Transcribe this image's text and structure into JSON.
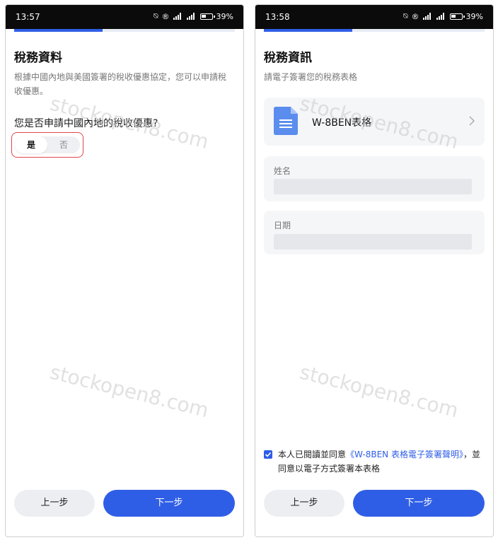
{
  "left": {
    "status": {
      "time": "13:57",
      "battery": "39"
    },
    "progress_fraction": 0.4,
    "title": "稅務資料",
    "subtitle": "根據中國內地與美國簽署的稅收優惠協定，您可以申請稅收優惠。",
    "question": "您是否申請中國內地的稅收優惠?",
    "toggle": {
      "yes": "是",
      "no": "否",
      "selected": "是"
    },
    "buttons": {
      "prev": "上一步",
      "next": "下一步"
    },
    "watermark": "stockopen8.com"
  },
  "right": {
    "status": {
      "time": "13:58",
      "battery": "39"
    },
    "progress_fraction": 0.4,
    "title": "稅務資訊",
    "subtitle": "請電子簽署您的稅務表格",
    "doc": {
      "name": "W-8BEN表格"
    },
    "fields": {
      "name_label": "姓名",
      "name_value": "",
      "date_label": "日期",
      "date_value": ""
    },
    "consent": {
      "checked": true,
      "pre": "本人已閱讀並同意",
      "link": "《W-8BEN 表格電子簽署聲明》",
      "post": "，並同意以電子方式簽署本表格"
    },
    "buttons": {
      "prev": "上一步",
      "next": "下一步"
    },
    "watermark": "stockopen8.com"
  },
  "colors": {
    "accent": "#2f5ee6",
    "highlight": "#e0464e",
    "doc_icon": "#5b8def"
  }
}
